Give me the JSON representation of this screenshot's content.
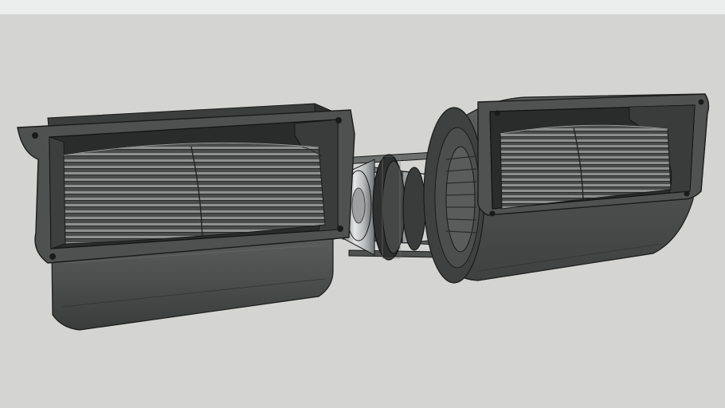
{
  "scene": {
    "subject": "twin-blower-assembly",
    "colors": {
      "top_strip": "#eceeed",
      "background": "#d4d4d2",
      "housing_dark": "#3c3d3d",
      "housing_mid": "#555757",
      "housing_light": "#6c6e6e",
      "flange": "#4e5050",
      "blade_light": "#8a8c8c",
      "motor_silver": "#c8cbcc",
      "outline": "#1a1a1a"
    },
    "elements": [
      "left-blower-housing",
      "left-impeller-wheel",
      "right-blower-housing",
      "right-impeller-wheel",
      "center-motor",
      "motor-mounting-rods"
    ]
  }
}
